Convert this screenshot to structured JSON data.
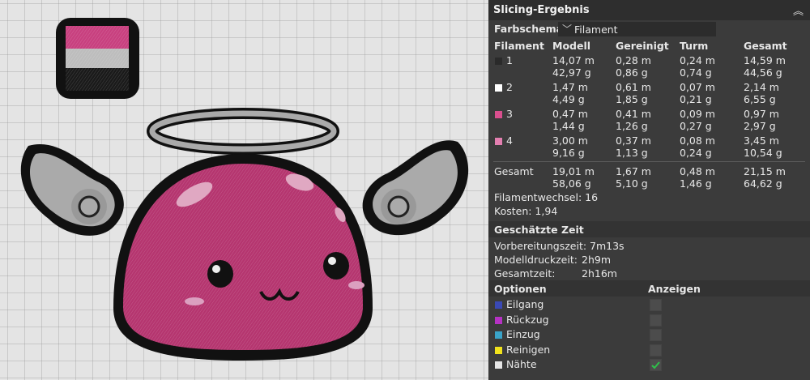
{
  "panel": {
    "title": "Slicing-Ergebnis",
    "color_scheme_label": "Farbschema",
    "color_scheme_value": "Filament",
    "columns": [
      "Filament",
      "Modell",
      "Gereinigt",
      "Turm",
      "Gesamt"
    ],
    "rows": [
      {
        "id": "1",
        "color": "#2a2a2a",
        "modell": [
          "14,07 m",
          "42,97 g"
        ],
        "gereinigt": [
          "0,28 m",
          "0,86 g"
        ],
        "turm": [
          "0,24 m",
          "0,74 g"
        ],
        "gesamt": [
          "14,59 m",
          "44,56 g"
        ]
      },
      {
        "id": "2",
        "color": "#ffffff",
        "modell": [
          "1,47 m",
          "4,49 g"
        ],
        "gereinigt": [
          "0,61 m",
          "1,85 g"
        ],
        "turm": [
          "0,07 m",
          "0,21 g"
        ],
        "gesamt": [
          "2,14 m",
          "6,55 g"
        ]
      },
      {
        "id": "3",
        "color": "#d94f8e",
        "modell": [
          "0,47 m",
          "1,44 g"
        ],
        "gereinigt": [
          "0,41 m",
          "1,26 g"
        ],
        "turm": [
          "0,09 m",
          "0,27 g"
        ],
        "gesamt": [
          "0,97 m",
          "2,97 g"
        ]
      },
      {
        "id": "4",
        "color": "#e37fb0",
        "modell": [
          "3,00 m",
          "9,16 g"
        ],
        "gereinigt": [
          "0,37 m",
          "1,13 g"
        ],
        "turm": [
          "0,08 m",
          "0,24 g"
        ],
        "gesamt": [
          "3,45 m",
          "10,54 g"
        ]
      }
    ],
    "total": {
      "label": "Gesamt",
      "modell": [
        "19,01 m",
        "58,06 g"
      ],
      "gereinigt": [
        "1,67 m",
        "5,10 g"
      ],
      "turm": [
        "0,48 m",
        "1,46 g"
      ],
      "gesamt": [
        "21,15 m",
        "64,62 g"
      ]
    },
    "filament_changes": "Filamentwechsel: 16",
    "cost": "Kosten: 1,94",
    "time_section": "Geschätzte Zeit",
    "prep_time": "Vorbereitungszeit: 7m13s",
    "model_print_label": "Modelldruckzeit:",
    "model_print_value": "2h9m",
    "total_time_label": "Gesamtzeit:",
    "total_time_value": "2h16m",
    "options_label": "Optionen",
    "show_label": "Anzeigen",
    "options": [
      {
        "label": "Eilgang",
        "color": "#3a49b5",
        "checked": false
      },
      {
        "label": "Rückzug",
        "color": "#b632c4",
        "checked": false
      },
      {
        "label": "Einzug",
        "color": "#3aa3c8",
        "checked": false
      },
      {
        "label": "Reinigen",
        "color": "#f1e21c",
        "checked": false
      },
      {
        "label": "Nähte",
        "color": "#e6e6e6",
        "checked": true
      }
    ]
  },
  "colors": {
    "check": "#2fbf4a",
    "panel_bg": "#3b3b3b"
  }
}
